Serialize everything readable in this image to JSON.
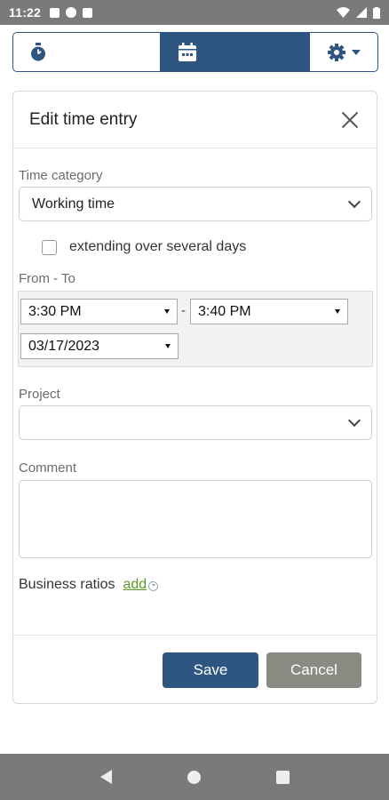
{
  "status_bar": {
    "time": "11:22"
  },
  "toolbar": {
    "timer_icon": "stopwatch-icon",
    "calendar_icon": "calendar-icon",
    "settings_icon": "gear-icon"
  },
  "dialog": {
    "title": "Edit time entry",
    "time_category": {
      "label": "Time category",
      "value": "Working time"
    },
    "multi_day": {
      "label": "extending over several days",
      "checked": false
    },
    "range": {
      "label": "From - To",
      "from_time": "3:30 PM",
      "separator": "-",
      "to_time": "3:40 PM",
      "date": "03/17/2023"
    },
    "project": {
      "label": "Project",
      "value": ""
    },
    "comment": {
      "label": "Comment",
      "value": ""
    },
    "business_ratios": {
      "label": "Business ratios",
      "add_label": "add"
    },
    "buttons": {
      "save": "Save",
      "cancel": "Cancel"
    }
  },
  "colors": {
    "primary": "#2e5680",
    "cancel": "#8a8a82",
    "link": "#5a9a2a"
  }
}
